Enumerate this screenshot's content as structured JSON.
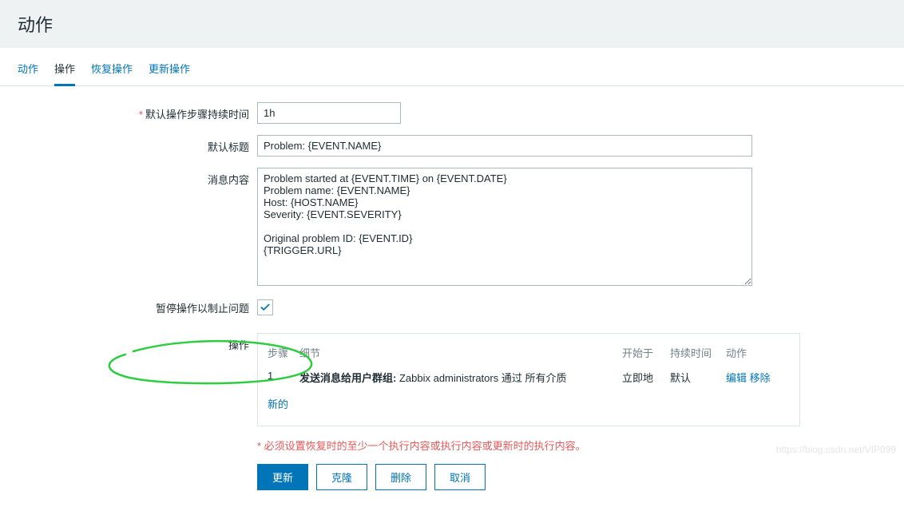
{
  "header": {
    "title": "动作"
  },
  "tabs": [
    {
      "label": "动作"
    },
    {
      "label": "操作",
      "active": true
    },
    {
      "label": "恢复操作"
    },
    {
      "label": "更新操作"
    }
  ],
  "form": {
    "duration": {
      "label": "默认操作步骤持续时间",
      "value": "1h",
      "required": true
    },
    "subject": {
      "label": "默认标题",
      "value": "Problem: {EVENT.NAME}"
    },
    "message": {
      "label": "消息内容",
      "value": "Problem started at {EVENT.TIME} on {EVENT.DATE}\nProblem name: {EVENT.NAME}\nHost: {HOST.NAME}\nSeverity: {EVENT.SEVERITY}\n\nOriginal problem ID: {EVENT.ID}\n{TRIGGER.URL}"
    },
    "pause": {
      "label": "暂停操作以制止问题",
      "checked": true
    },
    "operations": {
      "label": "操作",
      "headers": {
        "step": "步骤",
        "detail": "细节",
        "start": "开始于",
        "duration": "持续时间",
        "action": "动作"
      },
      "rows": [
        {
          "step": "1",
          "detail_prefix": "发送消息给用户群组:",
          "detail_body": " Zabbix administrators 通过 所有介质",
          "start": "立即地",
          "duration": "默认",
          "edit": "编辑",
          "remove": "移除"
        }
      ],
      "new_label": "新的"
    },
    "warning": "* 必须设置恢复时的至少一个执行内容或执行内容或更新时的执行内容。",
    "buttons": {
      "update": "更新",
      "clone": "克隆",
      "delete": "删除",
      "cancel": "取消"
    }
  },
  "watermark": "https://blog.csdn.net/VIP099"
}
